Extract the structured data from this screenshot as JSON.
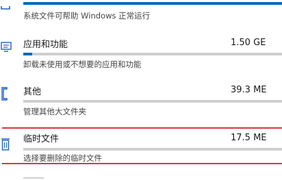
{
  "system_row": {
    "description": "系统文件可帮助 Windows 正常运行",
    "usage_fraction": 1.0
  },
  "apps_row": {
    "icon": "apps-features-icon",
    "title": "应用和功能",
    "size": "1.50 GE",
    "description": "卸载未使用或不想要的应用和功能",
    "usage_fraction": 0.035
  },
  "other_row": {
    "icon": "other-files-icon",
    "title": "其他",
    "size": "39.3 ME",
    "description": "管理其他大文件夹",
    "usage_fraction": 0.0
  },
  "temp_row": {
    "icon": "trash-icon",
    "title": "临时文件",
    "size": "17.5 ME",
    "description": "选择要删除的临时文件",
    "usage_fraction": 0.0
  },
  "colors": {
    "accent": "#0067c0",
    "highlight": "#d9363e"
  }
}
